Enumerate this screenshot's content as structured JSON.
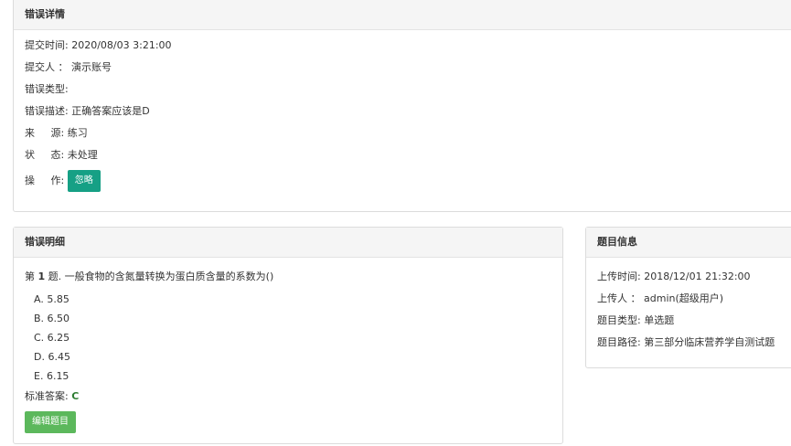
{
  "error_details": {
    "title": "错误详情",
    "submit_time_label": "提交时间:",
    "submit_time_value": "2020/08/03 3:21:00",
    "submitter_label": "提交人 ：",
    "submitter_value": "演示账号",
    "error_type_label": "错误类型:",
    "error_type_value": "",
    "error_desc_label": "错误描述:",
    "error_desc_value": "正确答案应该是D",
    "source_label": "来     源:",
    "source_value": "练习",
    "status_label": "状     态:",
    "status_value": "未处理",
    "action_label": "操     作:",
    "ignore_button": "忽略",
    "accent_color": "#16a085"
  },
  "error_breakdown": {
    "title": "错误明细",
    "question_prefix": "第",
    "question_number": "1",
    "question_suffix": "题.",
    "question_text": "一般食物的含氮量转换为蛋白质含量的系数为()",
    "options": [
      "A. 5.85",
      "B. 6.50",
      "C. 6.25",
      "D. 6.45",
      "E. 6.15"
    ],
    "standard_answer_label": "标准答案:",
    "standard_answer_value": "C",
    "edit_button": "编辑题目",
    "edit_button_color": "#5cb85c"
  },
  "question_info": {
    "title": "题目信息",
    "upload_time_label": "上传时间:",
    "upload_time_value": "2018/12/01 21:32:00",
    "uploader_label": "上传人 ：",
    "uploader_value": "admin(超级用户)",
    "type_label": "题目类型:",
    "type_value": "单选题",
    "path_label": "题目路径:",
    "path_value": "第三部分临床营养学自测试题"
  }
}
